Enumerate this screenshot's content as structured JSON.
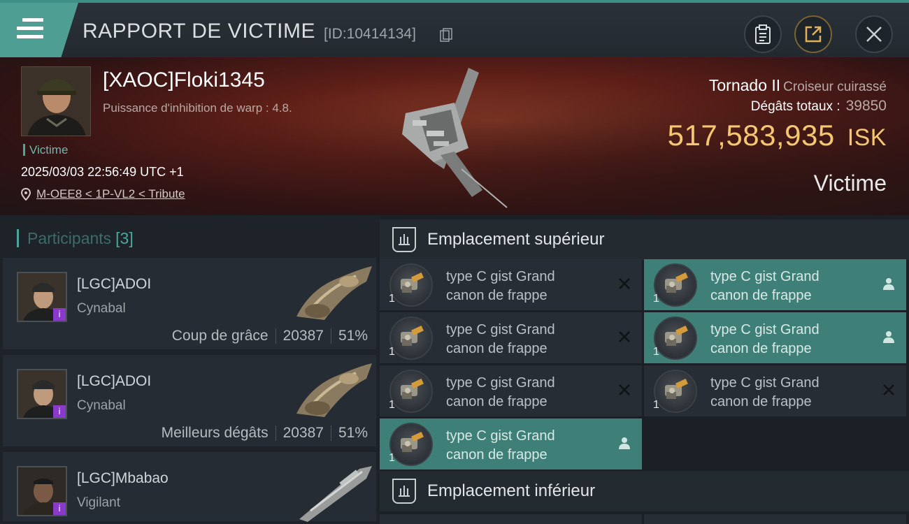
{
  "header": {
    "title": "RAPPORT DE VICTIME",
    "id_text": "[ID:10414134]",
    "icons": [
      "menu-icon",
      "clipboard-icon",
      "share-icon",
      "close-icon"
    ]
  },
  "victim": {
    "name": "[XAOC]Floki1345",
    "warp_text": "Puissance d'inhibition de warp : 4.8.",
    "role_tag": "Victime",
    "datetime": "2025/03/03 22:56:49 UTC +1",
    "location": "M-OEE8 < 1P-VL2 < Tribute",
    "ship_name": "Tornado II",
    "ship_class": "Croiseur cuirassé",
    "damage_label": "Dégâts totaux :",
    "damage_value": "39850",
    "isk_value": "517,583,935",
    "isk_unit": "ISK",
    "verdict": "Victime"
  },
  "participants": {
    "label": "Participants",
    "count": "[3]",
    "rows": [
      {
        "name": "[LGC]ADOI",
        "ship": "Cynabal",
        "stat_label": "Coup de grâce",
        "damage": "20387",
        "percent": "51%"
      },
      {
        "name": "[LGC]ADOI",
        "ship": "Cynabal",
        "stat_label": "Meilleurs dégâts",
        "damage": "20387",
        "percent": "51%"
      },
      {
        "name": "[LGC]Mbabao",
        "ship": "Vigilant"
      }
    ]
  },
  "slots": {
    "upper_title": "Emplacement supérieur",
    "lower_title": "Emplacement inférieur",
    "modules": [
      {
        "name": "type C gist Grand canon de frappe",
        "qty": "1",
        "status": "destroyed"
      },
      {
        "name": "type C gist Grand canon de frappe",
        "qty": "1",
        "status": "dropped"
      },
      {
        "name": "type C gist Grand canon de frappe",
        "qty": "1",
        "status": "destroyed"
      },
      {
        "name": "type C gist Grand canon de frappe",
        "qty": "1",
        "status": "dropped"
      },
      {
        "name": "type C gist Grand canon de frappe",
        "qty": "1",
        "status": "destroyed"
      },
      {
        "name": "type C gist Grand canon de frappe",
        "qty": "1",
        "status": "destroyed"
      },
      {
        "name": "type C gist Grand canon de frappe",
        "qty": "1",
        "status": "dropped"
      }
    ]
  },
  "colors": {
    "accent": "#4aa89a",
    "isk_gold": "#f4c770",
    "active_module": "#3e8078"
  }
}
